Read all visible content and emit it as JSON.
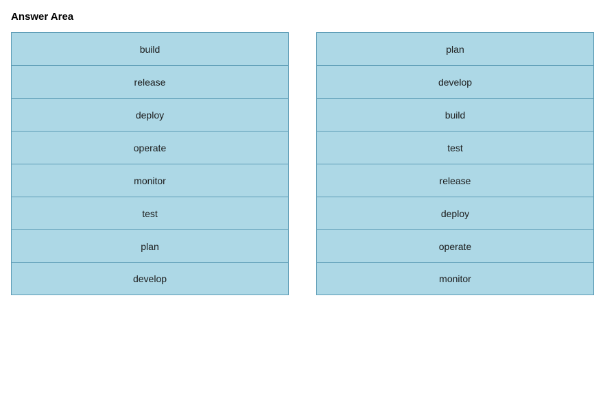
{
  "title": "Answer Area",
  "left_column": {
    "items": [
      {
        "label": "build"
      },
      {
        "label": "release"
      },
      {
        "label": "deploy"
      },
      {
        "label": "operate"
      },
      {
        "label": "monitor"
      },
      {
        "label": "test"
      },
      {
        "label": "plan"
      },
      {
        "label": "develop"
      }
    ]
  },
  "right_column": {
    "items": [
      {
        "label": "plan"
      },
      {
        "label": "develop"
      },
      {
        "label": "build"
      },
      {
        "label": "test"
      },
      {
        "label": "release"
      },
      {
        "label": "deploy"
      },
      {
        "label": "operate"
      },
      {
        "label": "monitor"
      }
    ]
  }
}
